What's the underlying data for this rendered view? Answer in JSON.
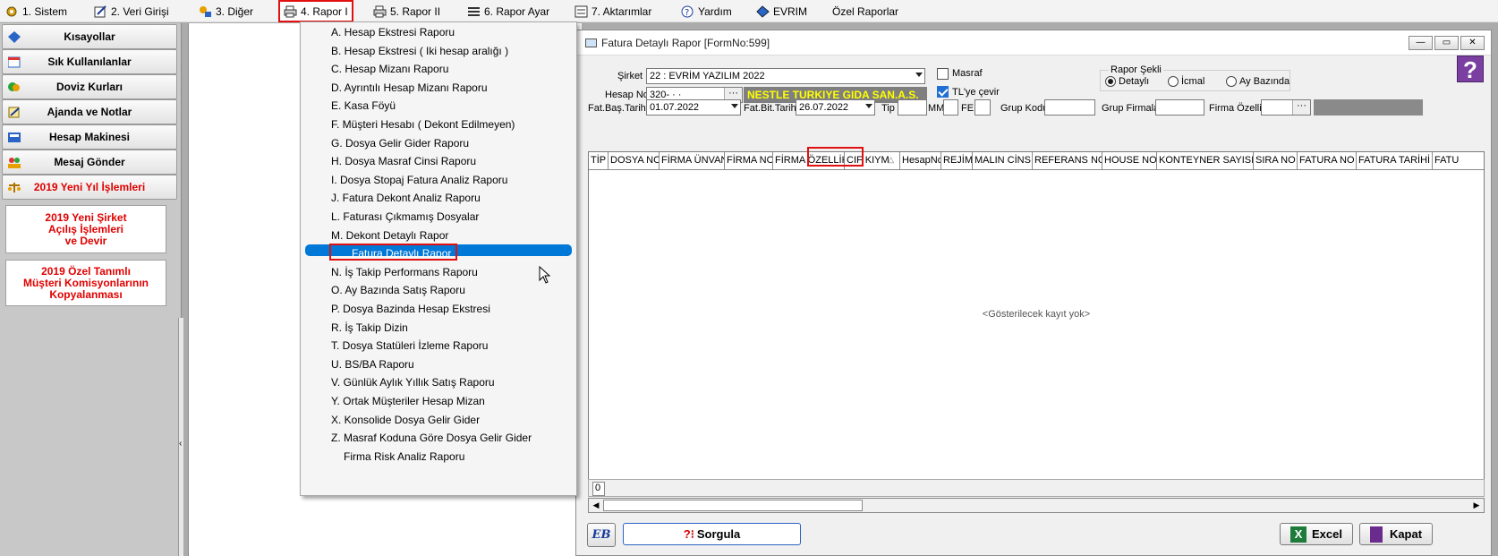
{
  "menubar": {
    "items": [
      {
        "label": "1.  Sistem"
      },
      {
        "label": "2.  Veri Girişi"
      },
      {
        "label": "3.  Diğer"
      },
      {
        "label": "4.  Rapor I"
      },
      {
        "label": "5.  Rapor II"
      },
      {
        "label": "6.  Rapor Ayar"
      },
      {
        "label": "7.  Aktarımlar"
      },
      {
        "label": "Yardım"
      },
      {
        "label": "EVRIM"
      },
      {
        "label": "Özel Raporlar"
      }
    ]
  },
  "sidebar": {
    "items": [
      {
        "label": "Kısayollar",
        "icon": "diamond-icon"
      },
      {
        "label": "Sık Kullanılanlar",
        "icon": "calendar-icon"
      },
      {
        "label": "Doviz Kurları",
        "icon": "currency-icon"
      },
      {
        "label": "Ajanda ve Notlar",
        "icon": "notes-icon"
      },
      {
        "label": "Hesap Makinesi",
        "icon": "calculator-icon"
      },
      {
        "label": "Mesaj Gönder",
        "icon": "users-icon"
      },
      {
        "label": "2019 Yeni Yıl İşlemleri",
        "icon": "scale-icon"
      }
    ],
    "panel1": [
      "2019 Yeni Şirket",
      "Açılış İşlemleri",
      "ve Devir"
    ],
    "panel2": [
      "2019 Özel Tanımlı",
      "Müşteri Komisyonlarının",
      "Kopyalanması"
    ],
    "splitter_glyph": "‹"
  },
  "dropdown": {
    "items": [
      "A.   Hesap Ekstresi Raporu",
      "B.   Hesap Ekstresi ( Iki hesap aralığı )",
      "C.   Hesap Mizanı Raporu",
      "D.   Ayrıntılı Hesap Mizanı Raporu",
      "E.   Kasa Föyü",
      "F.   Müşteri Hesabı ( Dekont Edilmeyen)",
      "G.   Dosya Gelir Gider Raporu",
      "H.   Dosya Masraf Cinsi Raporu",
      "I.   Dosya Stopaj Fatura Analiz Raporu",
      "J.   Fatura Dekont Analiz Raporu",
      "L.   Faturası Çıkmamış Dosyalar",
      "M.   Dekont Detaylı Rapor",
      "Fatura Detaylı Rapor",
      "N.   İş Takip Performans Raporu",
      "O.   Ay Bazında Satış Raporu",
      "P.   Dosya Bazinda Hesap Ekstresi",
      "R.   İş Takip Dizin",
      "T.   Dosya Statüleri İzleme Raporu",
      "U.   BS/BA Raporu",
      "V.   Günlük Aylık Yıllık Satış Raporu",
      "Y.   Ortak Müşteriler Hesap Mizan",
      "X.   Konsolide Dosya Gelir Gider",
      "Z.   Masraf Koduna Göre Dosya Gelir Gider",
      "Firma Risk Analiz Raporu"
    ]
  },
  "window": {
    "title": "Fatura Detaylı Rapor [FormNo:599]",
    "minimize_glyph": "—",
    "maximize_glyph": "▭",
    "close_glyph": "✕",
    "help_glyph": "?"
  },
  "form": {
    "sirket_label": "Şirket",
    "sirket_value": "22 : EVRİM YAZILIM  2022",
    "hesapno_label": "Hesap No",
    "hesapno_value": "320-  ·   ·",
    "ellipsis": "···",
    "customer_name": "NESTLE TURKIYE GIDA SAN.A.S.",
    "masraf_label": "Masraf",
    "tlye_label": "TL'ye çevir",
    "rapor_sekli_label": "Rapor Şekli",
    "radio_detayli": "Detaylı",
    "radio_icmal": "İcmal",
    "radio_ay": "Ay Bazında",
    "fat_bas_label": "Fat.Baş.Tarihi",
    "fat_bas_value": "01.07.2022",
    "fat_bit_label": "Fat.Bit.Tarihi",
    "fat_bit_value": "26.07.2022",
    "tip_label": "Tip",
    "mm_label": "MM",
    "fe_label": "FE",
    "grup_kodu_label": "Grup Kodu",
    "grup_firmalar_label": "Grup Firmalar",
    "firma_ozellik_label": "Firma Özellik"
  },
  "grid": {
    "columns": [
      "TİP",
      "DOSYA NO",
      "FİRMA ÜNVAN",
      "FİRMA NO",
      "FİRMA ÖZELLİK",
      "CIF KIYM",
      "HesapNo",
      "REJİM",
      "MALIN CİNSİ",
      "REFERANS NO",
      "HOUSE NO",
      "KONTEYNER SAYISI",
      "SIRA NO",
      "FATURA NO",
      "FATURA TARİHİ",
      "FATU"
    ],
    "sort_glyph": "△",
    "empty_text": "<Gösterilecek kayıt yok>",
    "row_count": "0",
    "scroll_left": "◀",
    "scroll_right": "▶"
  },
  "footer": {
    "sorgula_label": "Sorgula",
    "sorgula_prefix": "?⁝",
    "logo_text": "EB",
    "excel_label": "Excel",
    "kapat_label": "Kapat"
  },
  "colors": {
    "highlight_blue": "#0078d7",
    "red_outline": "#e01010",
    "badge_bg": "#7f7f7f",
    "badge_text": "#ffff00"
  }
}
